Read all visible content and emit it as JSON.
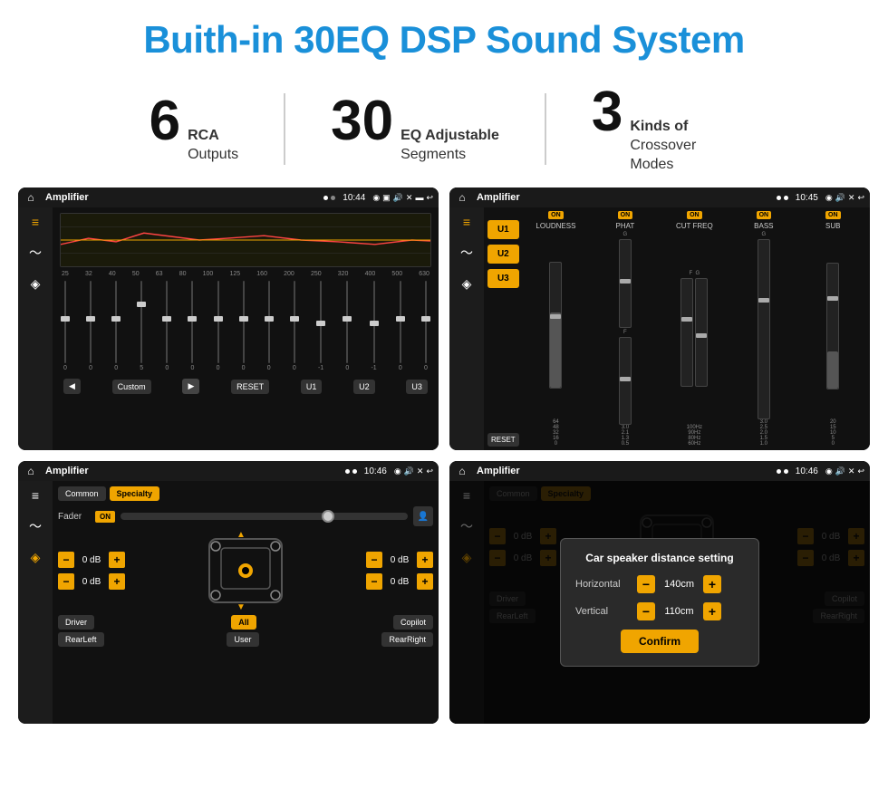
{
  "title": "Buith-in 30EQ DSP Sound System",
  "stats": [
    {
      "number": "6",
      "desc_line1": "RCA",
      "desc_line2": "Outputs"
    },
    {
      "number": "30",
      "desc_line1": "EQ Adjustable",
      "desc_line2": "Segments"
    },
    {
      "number": "3",
      "desc_line1": "Kinds of",
      "desc_line2": "Crossover Modes"
    }
  ],
  "screens": [
    {
      "id": "eq-screen",
      "app": "Amplifier",
      "time": "10:44",
      "type": "eq"
    },
    {
      "id": "amp-screen",
      "app": "Amplifier",
      "time": "10:45",
      "type": "amp"
    },
    {
      "id": "fader-screen",
      "app": "Amplifier",
      "time": "10:46",
      "type": "fader"
    },
    {
      "id": "distance-screen",
      "app": "Amplifier",
      "time": "10:46",
      "type": "distance"
    }
  ],
  "eq": {
    "freqs": [
      "25",
      "32",
      "40",
      "50",
      "63",
      "80",
      "100",
      "125",
      "160",
      "200",
      "250",
      "320",
      "400",
      "500",
      "630"
    ],
    "values": [
      "0",
      "0",
      "0",
      "5",
      "0",
      "0",
      "0",
      "0",
      "0",
      "0",
      "-1",
      "0",
      "-1",
      "",
      ""
    ],
    "presets": [
      "Custom",
      "RESET",
      "U1",
      "U2",
      "U3"
    ]
  },
  "amp": {
    "u_buttons": [
      "U1",
      "U2",
      "U3"
    ],
    "channels": [
      "LOUDNESS",
      "PHAT",
      "CUT FREQ",
      "BASS",
      "SUB"
    ],
    "on_label": "ON",
    "reset_label": "RESET"
  },
  "fader": {
    "tabs": [
      "Common",
      "Specialty"
    ],
    "fader_label": "Fader",
    "on_label": "ON",
    "db_values": [
      "0 dB",
      "0 dB",
      "0 dB",
      "0 dB"
    ],
    "bottom_btns": [
      "Driver",
      "All",
      "Copilot",
      "RearLeft",
      "User",
      "RearRight"
    ]
  },
  "distance": {
    "title": "Car speaker distance setting",
    "horizontal_label": "Horizontal",
    "horizontal_value": "140cm",
    "vertical_label": "Vertical",
    "vertical_value": "110cm",
    "confirm_label": "Confirm",
    "db_values": [
      "0 dB",
      "0 dB"
    ],
    "bottom_btns": [
      "Driver",
      "All",
      "Copilot",
      "RearLeft",
      "User",
      "RearRight"
    ]
  }
}
